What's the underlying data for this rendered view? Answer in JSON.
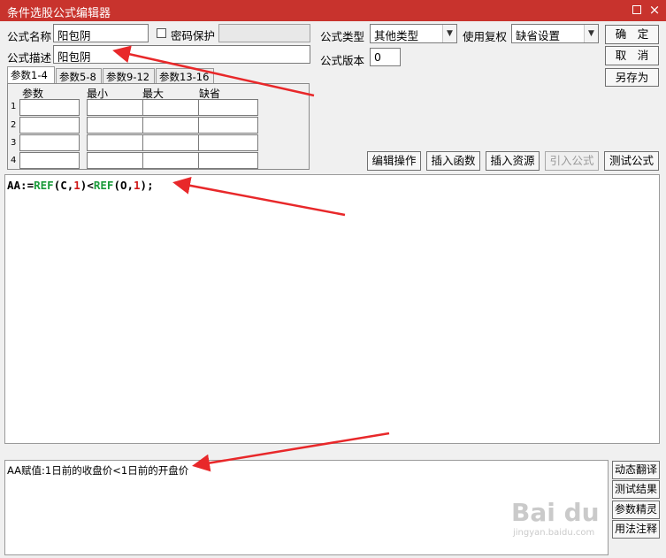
{
  "window": {
    "title": "条件选股公式编辑器",
    "close_glyph": "×"
  },
  "form": {
    "name_label": "公式名称",
    "name_value": "阳包阴",
    "password_label": "密码保护",
    "desc_label": "公式描述",
    "desc_value": "阳包阴",
    "type_label": "公式类型",
    "type_value": "其他类型",
    "reweight_label": "使用复权",
    "reweight_value": "缺省设置",
    "version_label": "公式版本",
    "version_value": "0"
  },
  "buttons": {
    "ok": "确　定",
    "cancel": "取　消",
    "save_as": "另存为",
    "edit_ops": "编辑操作",
    "insert_func": "插入函数",
    "insert_res": "插入资源",
    "import_formula": "引入公式",
    "test_formula": "测试公式"
  },
  "tabs": [
    "参数1-4",
    "参数5-8",
    "参数9-12",
    "参数13-16"
  ],
  "params": {
    "headers": [
      "参数",
      "最小",
      "最大",
      "缺省"
    ],
    "rows": [
      "1",
      "2",
      "3",
      "4"
    ]
  },
  "code": {
    "p1": "AA:=",
    "p2": "REF",
    "p3": "(C,",
    "p4": "1",
    "p5": ")<",
    "p6": "REF",
    "p7": "(O,",
    "p8": "1",
    "p9": ");"
  },
  "explain": {
    "text": "AA赋值:1日前的收盘价<1日前的开盘价"
  },
  "side_buttons": {
    "dynamic_translate": "动态翻译",
    "test_result": "测试结果",
    "param_wizard": "参数精灵",
    "usage_notes": "用法注释"
  },
  "watermark": {
    "brand": "Bai du",
    "url": "jingyan.baidu.com"
  },
  "colors": {
    "titlebar": "#c8332d",
    "arrow": "#e8282a",
    "code_keyword": "#1a9a3a",
    "code_number": "#d01818"
  }
}
